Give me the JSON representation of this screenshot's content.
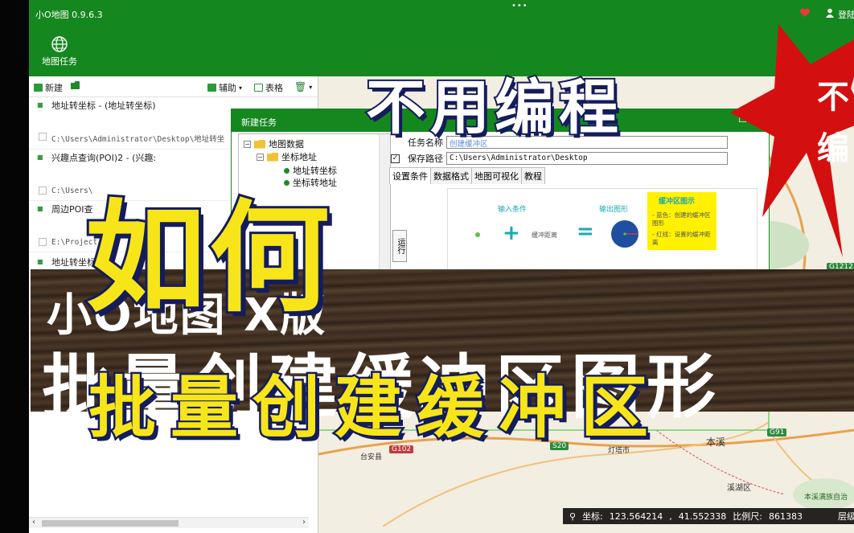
{
  "app": {
    "title": "小O地图 0.9.6.3",
    "dots": "•••",
    "login": "登陆",
    "ribbon_button": "地图任务"
  },
  "colors": {
    "brand_green": "#15871f",
    "headline_yellow": "#f7e51a",
    "headline_outline": "#141c5c",
    "burst_red": "#d40f0f"
  },
  "toolbar": {
    "new": "新建",
    "assist": "辅助",
    "table": "表格"
  },
  "tasks": [
    {
      "name": "地址转坐标 - (地址转坐标)",
      "path": "C:\\Users\\Administrator\\Desktop\\地址转坐"
    },
    {
      "name": "兴趣点查询(POI)2 - (兴趣:",
      "path": "C:\\Users\\"
    },
    {
      "name": "周边POI查",
      "path": "E:\\Project"
    },
    {
      "name": "地址转坐标",
      "path": ""
    }
  ],
  "dialog": {
    "title": "新建任务",
    "tree": {
      "root": "地图数据",
      "child": "坐标地址",
      "leaf": "地址转坐标",
      "leaf2": "坐标转地址"
    },
    "side_tab": "运行",
    "task_name_label": "任务名称",
    "task_name_value": "创建缓冲区",
    "save_path_label": "保存路径",
    "save_path_value": "C:\\Users\\Administrator\\Desktop",
    "tabs": [
      "设置条件",
      "数据格式",
      "地图可视化",
      "教程"
    ],
    "diagram": {
      "input_label": "输入条件",
      "output_label": "输出图形",
      "buffer_distance": "缓冲距离",
      "legend_title": "缓冲区图示",
      "legend_blue": "- 蓝色：创建的缓冲区图形",
      "legend_red": "- 红线：设置的缓冲距离"
    }
  },
  "map": {
    "roads": [
      "G1212",
      "G102",
      "S20",
      "G91"
    ],
    "places": [
      "本溪",
      "台安县",
      "灯塔市",
      "溪湖区",
      "本溪满族自治"
    ],
    "coord_label": "坐标:",
    "lng": "123.564214",
    "lat": "41.552338",
    "scale_label": "比例尺:",
    "scale_value": "861383",
    "level_label": "层级:"
  },
  "overlay": {
    "headline_top": "不用编程",
    "headline_mid": "如何",
    "headline_bottom": "批量创建缓冲区",
    "banner_line1": "小O地图 X版",
    "banner_line2": "批量创建缓冲区图形",
    "burst_line1": "不",
    "burst_line2": "编"
  }
}
